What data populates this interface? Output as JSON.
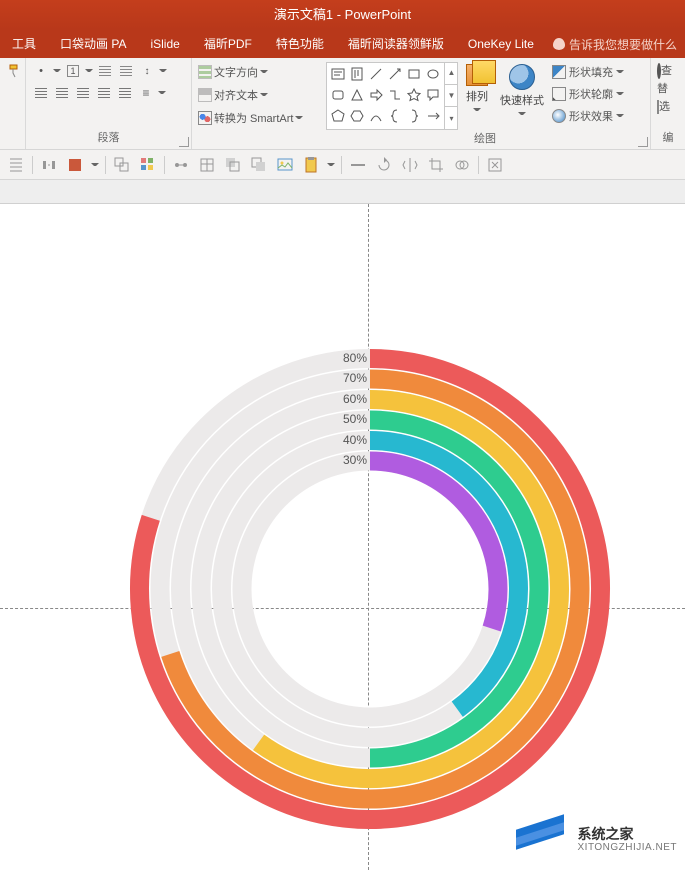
{
  "title": "演示文稿1 - PowerPoint",
  "tabs": [
    "工具",
    "口袋动画 PA",
    "iSlide",
    "福昕PDF",
    "特色功能",
    "福昕阅读器领鲜版",
    "OneKey Lite"
  ],
  "tell_me": "告诉我您想要做什么",
  "ribbon": {
    "paragraph_label": "段落",
    "text_direction": "文字方向",
    "align_text": "对齐文本",
    "convert_smartart": "转换为 SmartArt",
    "drawing_label": "绘图",
    "arrange": "排列",
    "quick_styles": "快速样式",
    "shape_fill": "形状填充",
    "shape_outline": "形状轮廓",
    "shape_effects": "形状效果",
    "editing_label": "编",
    "find": "查",
    "replace": "替",
    "select": "选"
  },
  "chart_data": {
    "type": "radial-bar",
    "series": [
      {
        "label": "80%",
        "value": 80,
        "color": "#ec5a5a"
      },
      {
        "label": "70%",
        "value": 70,
        "color": "#f08a3c"
      },
      {
        "label": "60%",
        "value": 60,
        "color": "#f5c23c"
      },
      {
        "label": "50%",
        "value": 50,
        "color": "#2ecc8f"
      },
      {
        "label": "40%",
        "value": 40,
        "color": "#27b8d0"
      },
      {
        "label": "30%",
        "value": 30,
        "color": "#b05ce0"
      }
    ],
    "track_color": "#eceaea",
    "start_angle_deg": -90,
    "direction": "clockwise"
  },
  "watermark": {
    "brand": "系统之家",
    "url": "XITONGZHIJIA.NET"
  }
}
